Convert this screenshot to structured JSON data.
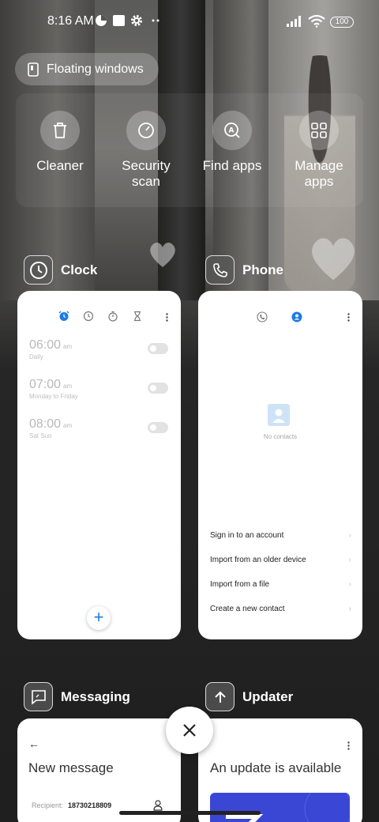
{
  "status_bar": {
    "time": "8:16 AM",
    "battery": "100",
    "icons": [
      "data-saver-icon",
      "square-notification-icon",
      "settings-gear-icon",
      "more-dots-icon",
      "signal-icon",
      "wifi-icon",
      "battery-icon"
    ]
  },
  "floating_windows": {
    "label": "Floating windows",
    "icon": "floating-window-icon"
  },
  "quick_actions": [
    {
      "label": "Cleaner",
      "icon": "trash-icon"
    },
    {
      "label": "Security scan",
      "icon": "gauge-icon"
    },
    {
      "label": "Find apps",
      "icon": "search-apps-icon"
    },
    {
      "label": "Manage apps",
      "icon": "grid-icon"
    }
  ],
  "recent_apps": {
    "clock": {
      "name": "Clock",
      "alarms": [
        {
          "time": "06:00",
          "ampm": "am",
          "repeat": "Daily",
          "enabled": false
        },
        {
          "time": "07:00",
          "ampm": "am",
          "repeat": "Monday to Friday",
          "enabled": false
        },
        {
          "time": "08:00",
          "ampm": "am",
          "repeat": "Sat Sun",
          "enabled": false
        }
      ],
      "fab": "+"
    },
    "phone": {
      "name": "Phone",
      "empty_text": "No contacts",
      "actions": [
        "Sign in to an account",
        "Import from an older device",
        "Import from a file",
        "Create a new contact"
      ]
    },
    "messaging": {
      "name": "Messaging",
      "back": "←",
      "title": "New message",
      "recipient_label": "Recipient:",
      "recipient_value": "18730218809"
    },
    "updater": {
      "name": "Updater",
      "title": "An update is available"
    }
  },
  "colors": {
    "accent_blue": "#1c7be6",
    "update_banner": "#3a47d5"
  }
}
